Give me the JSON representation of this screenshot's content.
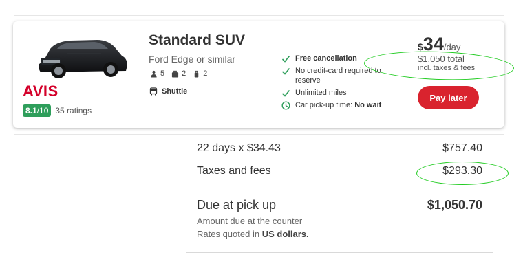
{
  "listing": {
    "title": "Standard SUV",
    "subtitle": "Ford Edge or similar",
    "passengers": "5",
    "large_bags": "2",
    "small_bags": "2",
    "shuttle": "Shuttle",
    "brand": "AVIS",
    "rating_score": "8.1",
    "rating_den": "/10",
    "rating_count": "35 ratings"
  },
  "features": [
    {
      "text": "Free cancellation",
      "bold": true
    },
    {
      "text": "No credit-card required to reserve"
    },
    {
      "text": "Unlimited miles"
    },
    {
      "label": "Car pick-up time:",
      "value": "No wait"
    }
  ],
  "price": {
    "currency": "$",
    "daily": "34",
    "unit": "/day",
    "total": "$1,050 total",
    "note": "incl. taxes & fees",
    "button": "Pay later"
  },
  "breakdown": {
    "row1_label": "22 days x $34.43",
    "row1_value": "$757.40",
    "row2_label": "Taxes and fees",
    "row2_value": "$293.30",
    "due_label": "Due at pick up",
    "due_value": "$1,050.70",
    "note1": "Amount due at the counter",
    "note2_prefix": "Rates quoted in",
    "note2_bold": "US dollars.",
    "note2_suffix": ""
  },
  "colors": {
    "accent_red": "#d9232e",
    "brand_red": "#d4002a",
    "rating_green": "#2e9e5b",
    "check_green": "#2e9e5b",
    "highlight_green": "#22cc22"
  }
}
